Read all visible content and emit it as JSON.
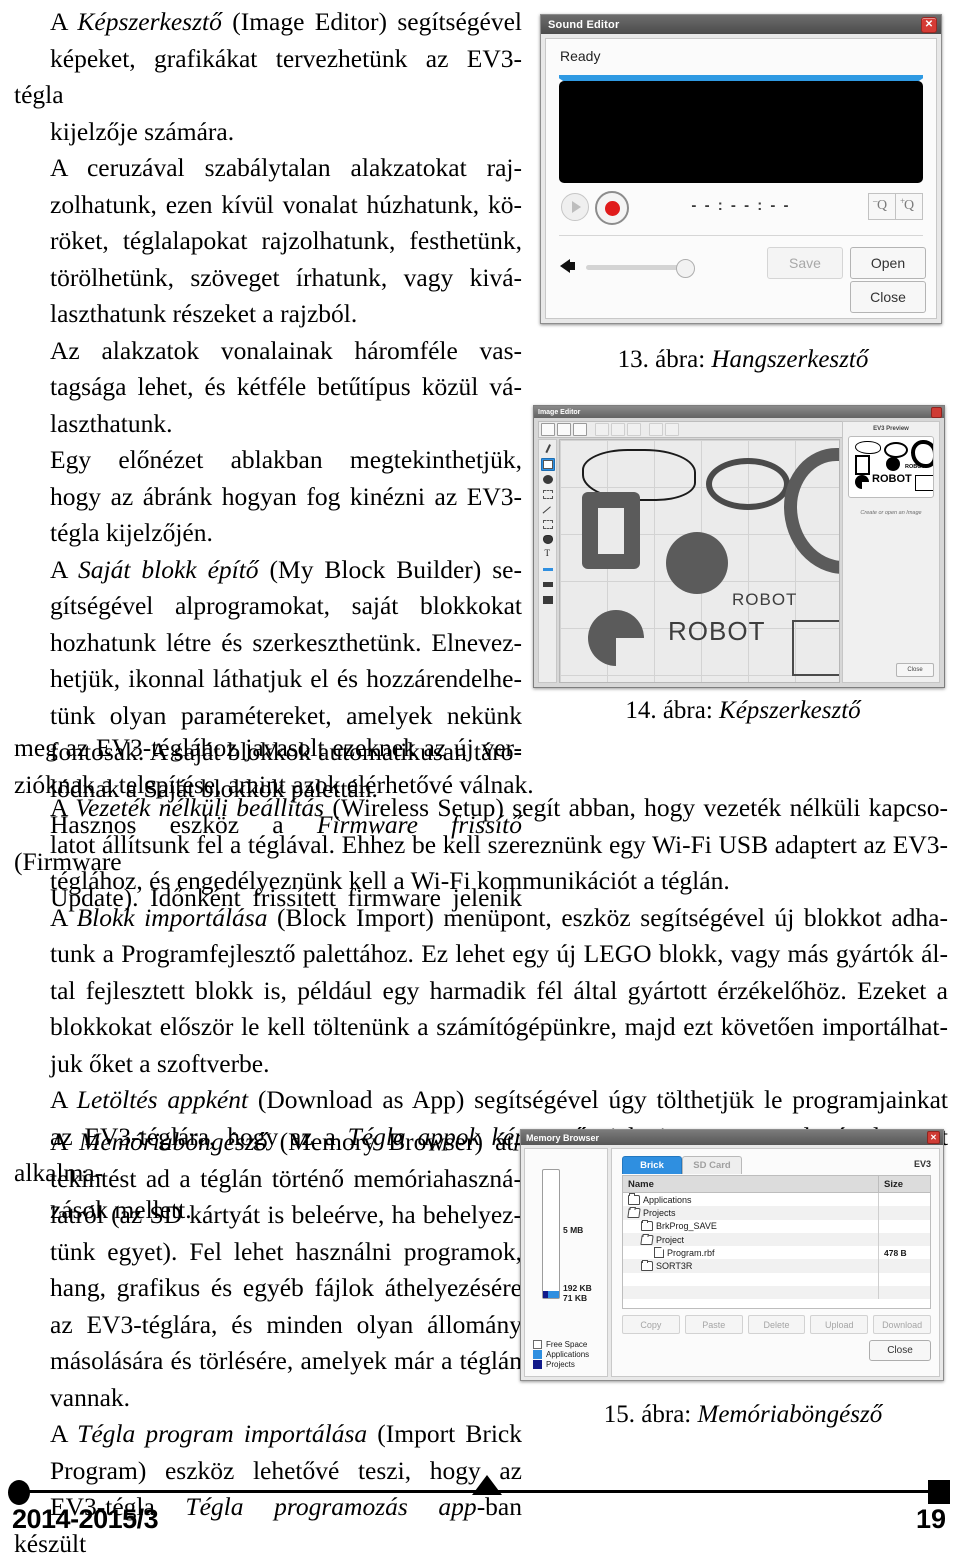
{
  "document": {
    "body_left_column": [
      "A Képszerkesztő (Image Editor) segítségével képeket, grafikákat tervezhetünk az EV3-tégla kijelzője számára.",
      "A ceruzával szabálytalan alakzatokat rajzolhatunk, ezen kívül vonalat húzhatunk, köröket, téglalapokat rajzolhatunk, festhetünk, törölhetünk, szöveget írhatunk, vagy kiválaszthatunk részeket a rajzból.",
      "Az alakzatok vonalainak háromféle vastagsága lehet, és kétféle betűtípus közül választhatunk.",
      "Egy előnézet ablakban megtekinthetjük, hogy az ábránk hogyan fog kinézni az EV3-tégla kijelzőjén.",
      "A Saját blokk építő (My Block Builder) segítségével alprogramokat, saját blokkokat hozhatunk létre és szerkeszthetünk. Elnevezhetjük, ikonnal láthatjuk el és hozzárendelhetünk olyan paramétereket, amelyek nekünk fontosak. A saját blokkok automatikusan tárolódnak a Saját blokkok palettán.",
      "Hasznos eszköz a Firmware frissítő (Firmware Update). Időnként frissített firmware jelenik meg az EV3-téglához javasolt ezeknek az új verzióknak a telepítése, amint azok elérhetővé válnak."
    ],
    "paragraph_1_lines": [
      "A Képszerkesztő (Image Editor) segítségével",
      "képeket, grafikákat tervezhetünk az EV3-tégla",
      "kijelzője számára."
    ],
    "paragraph_2_lines": [
      "A ceruzával szabálytalan alakzatokat raj-",
      "zolhatunk, ezen kívül vonalat húzhatunk, kö-",
      "röket, téglalapokat rajzolhatunk, festhetünk,",
      "törölhetünk, szöveget írhatunk, vagy kivá-",
      "laszthatunk részeket a rajzból."
    ],
    "paragraph_3_lines": [
      "Az alakzatok vonalainak háromféle vas-",
      "tagsága lehet, és kétféle betűtípus közül vá-",
      "laszthatunk."
    ],
    "paragraph_4_lines": [
      "Egy előnézet ablakban megtekinthetjük,",
      "hogy az ábránk hogyan fog kinézni az EV3-",
      "tégla kijelzőjén."
    ],
    "paragraph_5_lines": [
      "A Saját blokk építő (My Block Builder) se-",
      "gítségével alprogramokat, saját blokkokat",
      "hozhatunk létre és szerkeszthetünk. Elnevez-",
      "hetjük, ikonnal láthatjuk el és hozzárendelhe-",
      "tünk olyan paramétereket, amelyek nekünk",
      "fontosak. A saját blokkok automatikusan táro-",
      "lódnak a Saját blokkok palettán."
    ],
    "paragraph_6_lines": [
      "Hasznos eszköz a Firmware frissítő (Firmware",
      "Update). Időnként frissített firmware jelenik",
      "meg az EV3-téglához javasolt ezeknek az új ver-",
      "zióknak a telepítése, amint azok elérhetővé válnak."
    ],
    "paragraph_7_lines": [
      "A Vezeték nélküli beállítás (Wireless Setup) segít abban, hogy vezeték nélküli kapcso-",
      "latot állítsunk fel a téglával. Ehhez be kell szereznünk egy Wi-Fi USB adaptert az EV3-",
      "téglához, és engedélyeznünk kell a Wi-Fi kommunikációt a téglán."
    ],
    "paragraph_8_lines": [
      "A Blokk importálása (Block Import) menüpont, eszköz segítségével új blokkot adha-",
      "tunk a Programfejlesztő palettához. Ez lehet egy új LEGO blokk, vagy más gyártók ál-",
      "tal fejlesztett blokk is, például egy harmadik fél által gyártott érzékelőhöz. Ezeket a",
      "blokkokat először le kell töltenünk a számítógépünkre, majd ezt követően importálhat-",
      "juk őket a szoftverbe."
    ],
    "paragraph_9_lines": [
      "A Letöltés appként (Download as App) segítségével úgy tölthetjük le programjainkat",
      "az EV3-téglára, hogy az a Tégla appok képernyőn jelenjen meg az alapértelmezett alkalma-",
      "zások mellett."
    ],
    "paragraph_10_lines": [
      "A Memóriaböngésző (Memory Browser) át-",
      "tekintést ad a téglán történő memóriahaszná-",
      "latról (az SD kártyát is beleérve, ha behelyez-",
      "tünk egyet). Fel lehet használni programok,",
      "hang, grafikus és egyéb fájlok áthelyezésére",
      "az EV3-téglára, és minden olyan állomány",
      "másolására és törlésére, amelyek már a téglán",
      "vannak."
    ],
    "paragraph_11_lines": [
      "A Tégla program importálása (Import Brick",
      "Program) eszköz lehetővé teszi, hogy az",
      "EV3-tégla Tégla programozás app-ban készült"
    ]
  },
  "figures": {
    "fig13_caption_number": "13. ábra:",
    "fig13_caption_title": "Hangszerkesztő",
    "fig14_caption_number": "14. ábra:",
    "fig14_caption_title": "Képszerkesztő",
    "fig15_caption_number": "15. ábra:",
    "fig15_caption_title": "Memóriaböngésző"
  },
  "sound_editor": {
    "title": "Sound Editor",
    "status": "Ready",
    "time": "- - : - - : - -",
    "zoom_out": "Q",
    "zoom_out_sup": "–",
    "zoom_in": "Q",
    "zoom_in_sup": "+",
    "save_label": "Save",
    "open_label": "Open",
    "close_label": "Close",
    "close_x": "✕"
  },
  "image_editor": {
    "title": "Image Editor",
    "preview_title": "EV3 Preview",
    "hint": "Create or open an Image",
    "close_label": "Close",
    "canvas_text_small": "ROBOT",
    "canvas_text_large": "ROBOT",
    "preview_text_small": "ROBOT",
    "preview_text_large": "ROBOT"
  },
  "memory_browser": {
    "title": "Memory Browser",
    "close_x": "✕",
    "tab_brick": "Brick",
    "tab_sdcard": "SD Card",
    "device": "EV3",
    "col_name": "Name",
    "col_size": "Size",
    "gauge": {
      "total": "5 MB",
      "apps": "192 KB",
      "projects": "71 KB"
    },
    "legend": {
      "free": "Free Space",
      "applications": "Applications",
      "projects": "Projects"
    },
    "rows": [
      {
        "name": "Applications",
        "size": "",
        "indent": 0,
        "icon": "folder-icon"
      },
      {
        "name": "Projects",
        "size": "",
        "indent": 0,
        "icon": "folder-open-icon"
      },
      {
        "name": "BrkProg_SAVE",
        "size": "",
        "indent": 1,
        "icon": "folder-icon"
      },
      {
        "name": "Project",
        "size": "",
        "indent": 1,
        "icon": "folder-open-icon"
      },
      {
        "name": "Program.rbf",
        "size": "478 B",
        "indent": 2,
        "icon": "file-icon"
      },
      {
        "name": "SORT3R",
        "size": "",
        "indent": 1,
        "icon": "folder-icon"
      },
      {
        "name": "",
        "size": "",
        "indent": 0,
        "icon": ""
      },
      {
        "name": "",
        "size": "",
        "indent": 0,
        "icon": ""
      }
    ],
    "actions": [
      "Copy",
      "Paste",
      "Delete",
      "Upload",
      "Download"
    ],
    "close_label": "Close"
  },
  "footer": {
    "issue": "2014-2015/3",
    "page": "19"
  },
  "colors": {
    "accent_blue": "#2f8fe0",
    "record_red": "#e01b1b",
    "close_red": "#cf3b34",
    "projects_navy": "#111a8a"
  }
}
